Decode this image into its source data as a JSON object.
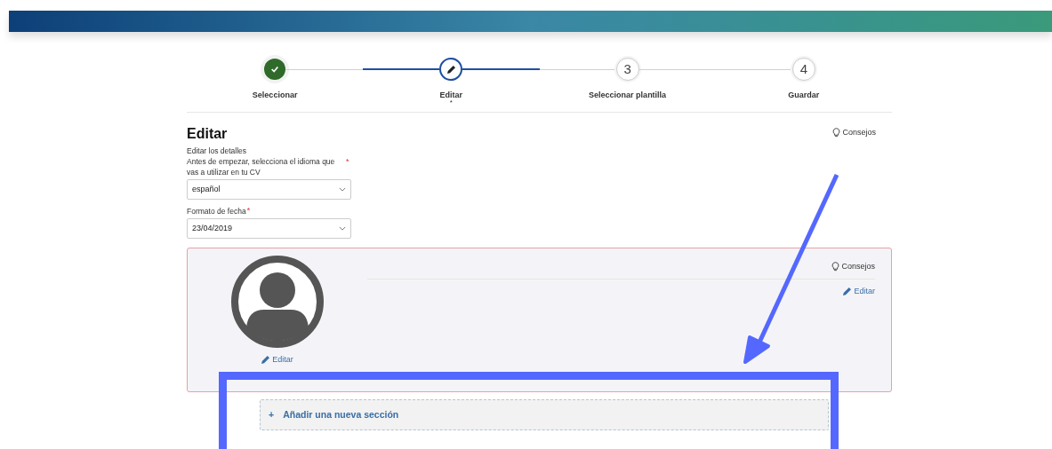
{
  "stepper": [
    {
      "kind": "done",
      "label": "Seleccionar",
      "selected": false
    },
    {
      "kind": "active",
      "label": "Editar",
      "selected": true,
      "note": "*"
    },
    {
      "kind": "number",
      "number": "3",
      "label": "Seleccionar plantilla",
      "selected": false
    },
    {
      "kind": "number",
      "number": "4",
      "label": "Guardar",
      "selected": false
    }
  ],
  "editor": {
    "title": "Editar",
    "tips": "Consejos",
    "subtitle": "Editar los detalles",
    "language_label": "Antes de empezar, selecciona el idioma que vas a utilizar en tu CV",
    "language_required": true,
    "language_value": "español",
    "date_label": "Formato de fecha",
    "date_required": true,
    "date_value": "23/04/2019"
  },
  "profile_card": {
    "photo_edit": "Editar",
    "tips": "Consejos",
    "edit": "Editar"
  },
  "add_section": {
    "icon": "+",
    "label": "Añadir una nueva sección"
  }
}
